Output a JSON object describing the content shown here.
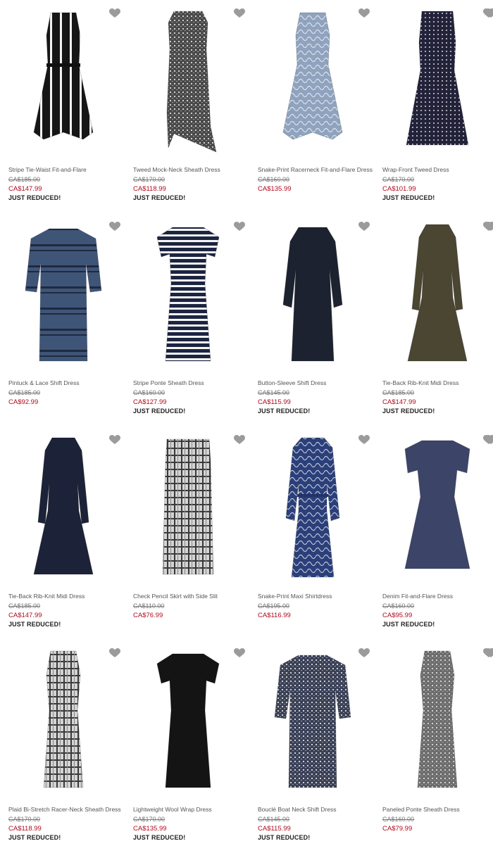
{
  "products": [
    {
      "name": "Stripe Tie-Waist Fit-and-Flare",
      "was": "CA$185.00",
      "now": "CA$147.99",
      "badge": "JUST REDUCED!",
      "color": "#161616",
      "pattern": "stripes",
      "shape": "flare"
    },
    {
      "name": "Tweed Mock-Neck Sheath Dress",
      "was": "CA$170.00",
      "now": "CA$118.99",
      "badge": "JUST REDUCED!",
      "color": "#4a4a4a",
      "pattern": "tweed",
      "shape": "asym"
    },
    {
      "name": "Snake-Print Racerneck Fit-and-Flare Dress",
      "was": "CA$160.00",
      "now": "CA$135.99",
      "badge": "",
      "color": "#8fa3bf",
      "pattern": "snake",
      "shape": "flare"
    },
    {
      "name": "Wrap-Front Tweed Dress",
      "was": "CA$170.00",
      "now": "CA$101.99",
      "badge": "JUST REDUCED!",
      "color": "#22223a",
      "pattern": "dots",
      "shape": "aline"
    },
    {
      "name": "Pintuck & Lace Shift Dress",
      "was": "CA$185.00",
      "now": "CA$92.99",
      "badge": "",
      "color": "#3f5578",
      "pattern": "lace",
      "shape": "shiftsleeve"
    },
    {
      "name": "Stripe Ponte Sheath Dress",
      "was": "CA$160.00",
      "now": "CA$127.99",
      "badge": "JUST REDUCED!",
      "color": "#1d2440",
      "pattern": "hstripes",
      "shape": "sheathsleeve"
    },
    {
      "name": "Button-Sleeve Shift Dress",
      "was": "CA$145.00",
      "now": "CA$115.99",
      "badge": "JUST REDUCED!",
      "color": "#1d2230",
      "pattern": "solid",
      "shape": "longshift"
    },
    {
      "name": "Tie-Back Rib-Knit Midi Dress",
      "was": "CA$185.00",
      "now": "CA$147.99",
      "badge": "JUST REDUCED!",
      "color": "#4a4632",
      "pattern": "solid",
      "shape": "longflare"
    },
    {
      "name": "Tie-Back Rib-Knit Midi Dress",
      "was": "CA$185.00",
      "now": "CA$147.99",
      "badge": "JUST REDUCED!",
      "color": "#1c2238",
      "pattern": "solid",
      "shape": "longflare"
    },
    {
      "name": "Check Pencil Skirt with Side Slit",
      "was": "CA$110.00",
      "now": "CA$76.99",
      "badge": "",
      "color": "#8a8a8a",
      "pattern": "check",
      "shape": "skirt"
    },
    {
      "name": "Snake-Print Maxi Shirtdress",
      "was": "CA$195.00",
      "now": "CA$116.99",
      "badge": "",
      "color": "#2b3f7a",
      "pattern": "snake",
      "shape": "maxi"
    },
    {
      "name": "Denim Fit-and-Flare Dress",
      "was": "CA$160.00",
      "now": "CA$95.99",
      "badge": "JUST REDUCED!",
      "color": "#3c4568",
      "pattern": "solid",
      "shape": "shortflare"
    },
    {
      "name": "Plaid Bi-Stretch Racer-Neck Sheath Dress",
      "was": "CA$170.00",
      "now": "CA$118.99",
      "badge": "JUST REDUCED!",
      "color": "#9a9a9a",
      "pattern": "check",
      "shape": "sheath"
    },
    {
      "name": "Lightweight Wool Wrap Dress",
      "was": "CA$170.00",
      "now": "CA$135.99",
      "badge": "JUST REDUCED!",
      "color": "#141414",
      "pattern": "solid",
      "shape": "sheathsleeve"
    },
    {
      "name": "Bouclé Boat Neck Shift Dress",
      "was": "CA$145.00",
      "now": "CA$115.99",
      "badge": "JUST REDUCED!",
      "color": "#3a4158",
      "pattern": "tweed",
      "shape": "shiftsleeve"
    },
    {
      "name": "Paneled Ponte Sheath Dress",
      "was": "CA$160.00",
      "now": "CA$79.99",
      "badge": "",
      "color": "#6d6d6d",
      "pattern": "tweed",
      "shape": "sheath"
    }
  ],
  "heart_color": "#9b9b9b",
  "extra_heart_icons": 4
}
